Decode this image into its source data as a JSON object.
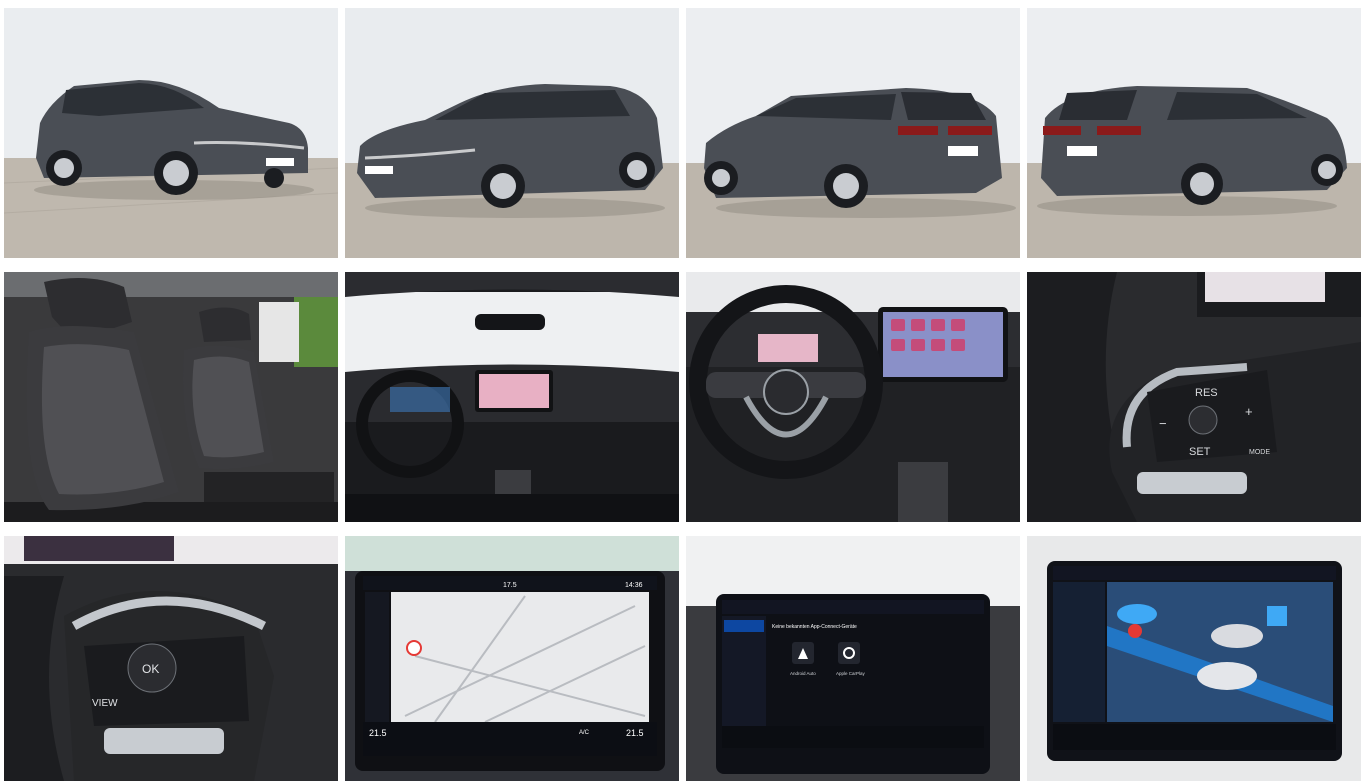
{
  "gallery": {
    "photos": [
      {
        "id": "exterior-front-left"
      },
      {
        "id": "exterior-front-right"
      },
      {
        "id": "exterior-rear-left"
      },
      {
        "id": "exterior-rear-right"
      },
      {
        "id": "front-seats"
      },
      {
        "id": "dashboard"
      },
      {
        "id": "cockpit"
      },
      {
        "id": "steering-wheel-right-controls"
      },
      {
        "id": "steering-wheel-left-controls"
      },
      {
        "id": "infotainment-navigation"
      },
      {
        "id": "infotainment-app-connect"
      },
      {
        "id": "infotainment-assist"
      }
    ]
  },
  "screens": {
    "temp_left": "21.5",
    "temp_right": "21.5",
    "top_temp": "17.5",
    "clock": "14:36",
    "ac_label": "A/C",
    "app_connect_title": "Keine bekannten App-Connect-Geräte",
    "android_auto": "Android Auto",
    "apple_carplay": "Apple CarPlay"
  },
  "wheel": {
    "res": "RES",
    "set": "SET",
    "mode": "MODE",
    "plus": "+",
    "minus": "−",
    "ok": "OK",
    "view": "VIEW"
  },
  "colors": {
    "car_paint": "#4a4e55",
    "wall": "#e9ecef",
    "pavement": "#bdb6ac",
    "screen_bg": "#0d1220",
    "accent_blue": "#1e88e5"
  }
}
